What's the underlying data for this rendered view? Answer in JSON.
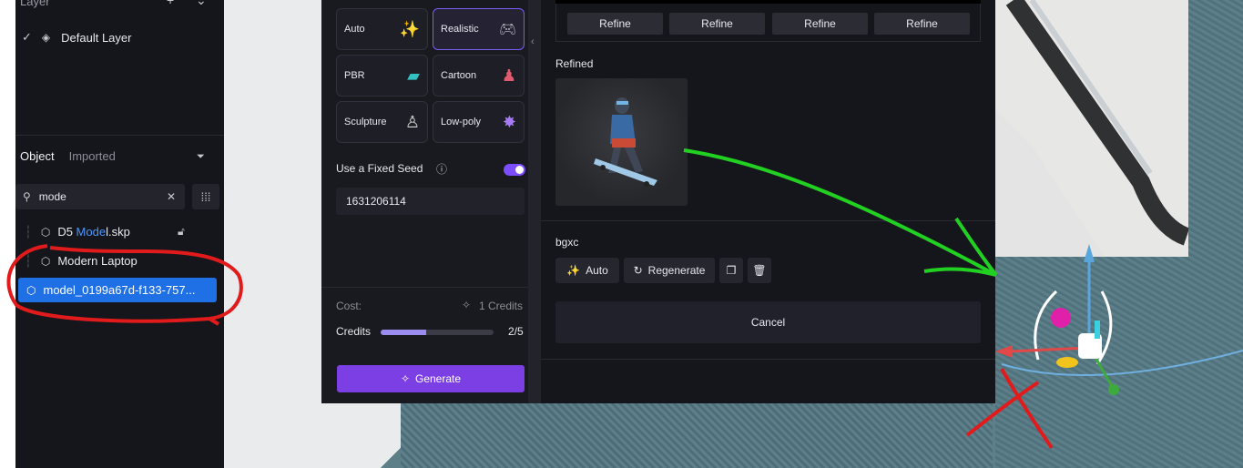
{
  "sidebar": {
    "layer_header": "Layer",
    "layers": [
      {
        "label": "Default Layer"
      }
    ],
    "tabs": {
      "object": "Object",
      "imported": "Imported"
    },
    "search": {
      "value": "mode"
    },
    "tree": [
      {
        "pre": "D5 ",
        "hl": "Mode",
        "post": "l.skp"
      },
      {
        "label": "Modern Laptop"
      },
      {
        "label": "model_0199a67d-f133-757..."
      }
    ]
  },
  "gen": {
    "styles": [
      {
        "label": "Auto",
        "icon": "magic-wand-icon"
      },
      {
        "label": "Realistic",
        "icon": "gamepad-icon"
      },
      {
        "label": "PBR",
        "icon": "pbr-icon"
      },
      {
        "label": "Cartoon",
        "icon": "cartoon-icon"
      },
      {
        "label": "Sculpture",
        "icon": "sculpture-icon"
      },
      {
        "label": "Low-poly",
        "icon": "lowpoly-icon"
      }
    ],
    "seed_label": "Use a Fixed Seed",
    "seed_value": "1631206114",
    "cost_label": "Cost:",
    "cost_value": "1 Credits",
    "credits_label": "Credits",
    "credits_value": "2/5",
    "credits_fraction": 0.4,
    "generate_label": "Generate"
  },
  "results": {
    "refine_labels": [
      "Refine",
      "Refine",
      "Refine",
      "Refine"
    ],
    "refined_title": "Refined",
    "item_name": "bgxc",
    "auto_label": "Auto",
    "regenerate_label": "Regenerate",
    "cancel_label": "Cancel"
  },
  "colors": {
    "accent": "#7b3fe4",
    "selection": "#1f6fe5",
    "annotation_red": "#e11b1b",
    "annotation_green": "#22d022"
  }
}
